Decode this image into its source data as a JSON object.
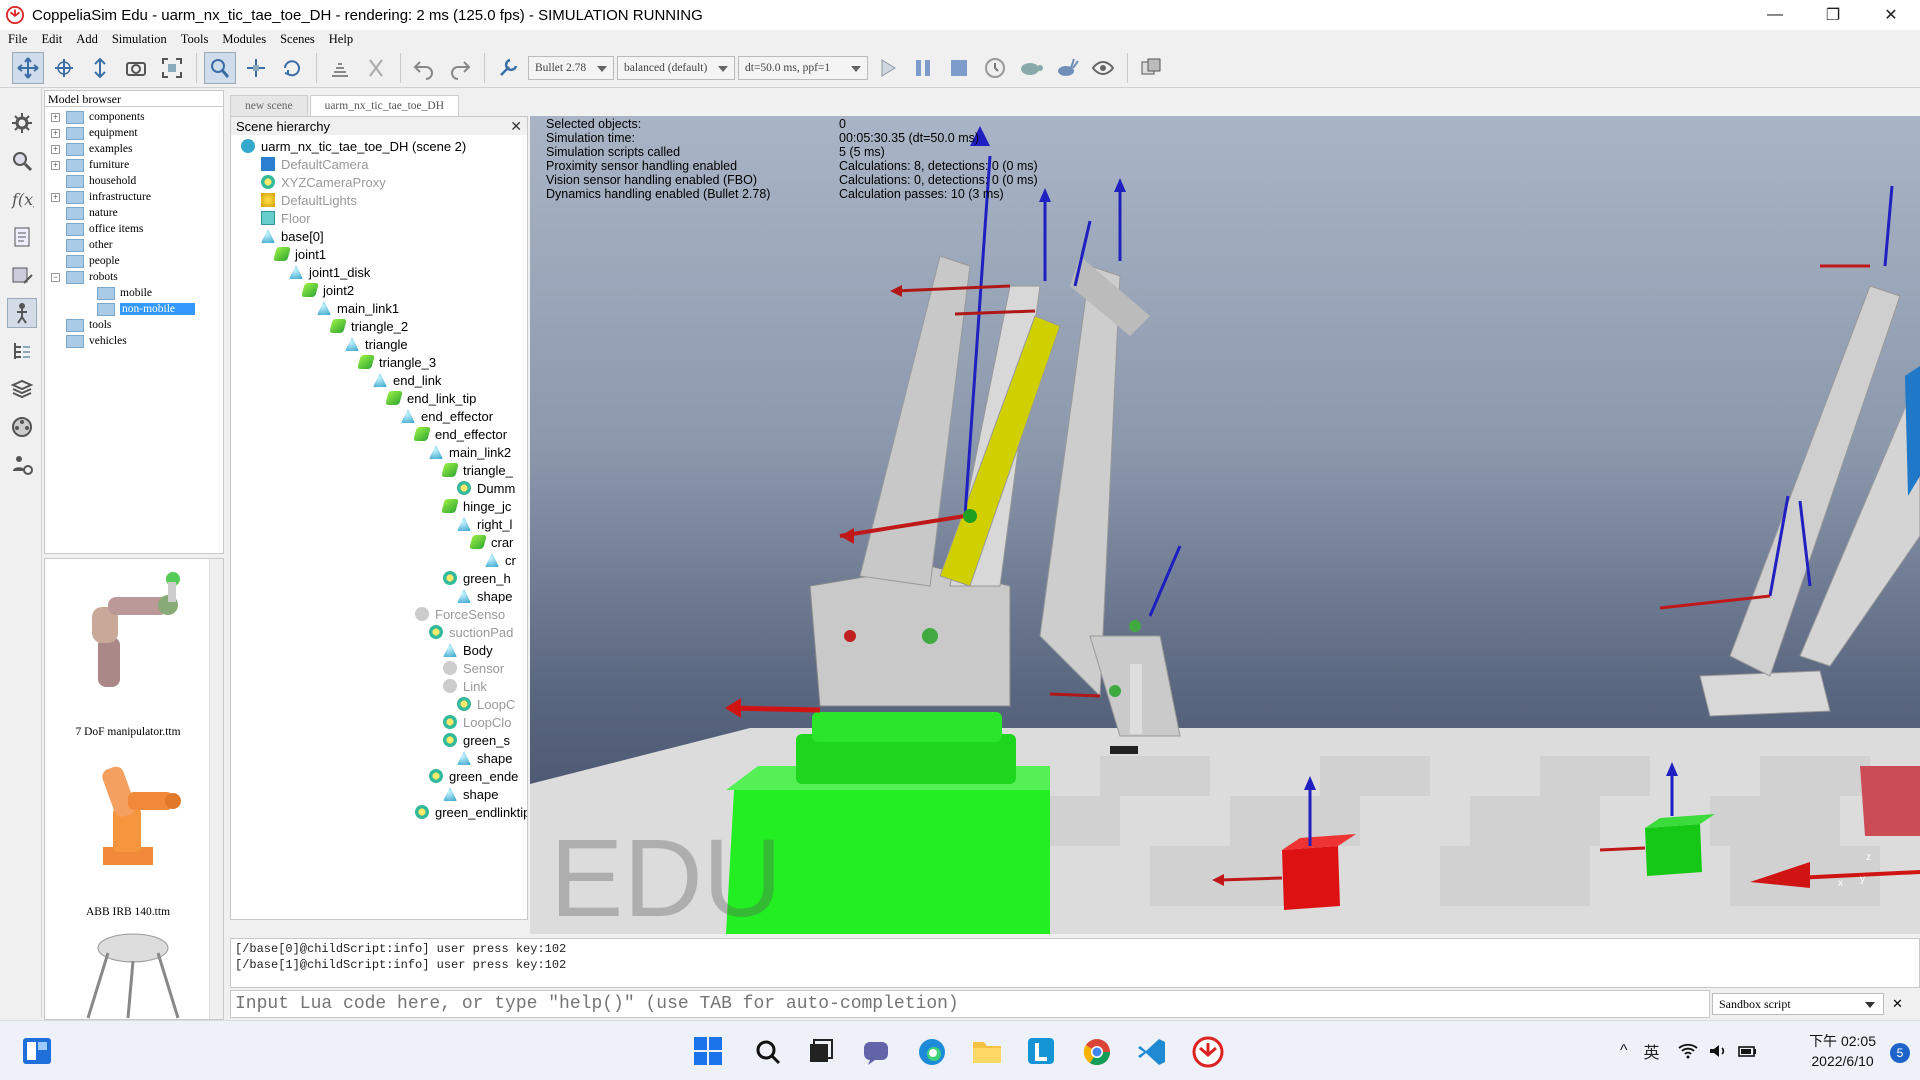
{
  "window": {
    "title": "CoppeliaSim Edu - uarm_nx_tic_tae_toe_DH - rendering: 2 ms (125.0 fps) - SIMULATION RUNNING",
    "minimize": "—",
    "restore": "❐",
    "close": "✕"
  },
  "menu": [
    "File",
    "Edit",
    "Add",
    "Simulation",
    "Tools",
    "Modules",
    "Scenes",
    "Help"
  ],
  "toolbar": {
    "engine": "Bullet 2.78",
    "accuracy": "balanced (default)",
    "dt": "dt=50.0 ms, ppf=1"
  },
  "model_browser": {
    "header": "Model browser",
    "items": [
      "components",
      "equipment",
      "examples",
      "furniture",
      "household",
      "infrastructure",
      "nature",
      "office items",
      "other",
      "people",
      "robots",
      "mobile",
      "non-mobile",
      "tools",
      "vehicles"
    ],
    "thumbnails": [
      "7 DoF manipulator.ttm",
      "ABB IRB 140.ttm"
    ]
  },
  "tabs": [
    "new scene",
    "uarm_nx_tic_tae_toe_DH"
  ],
  "hierarchy": {
    "header": "Scene hierarchy",
    "items": [
      "uarm_nx_tic_tae_toe_DH (scene 2)",
      "DefaultCamera",
      "XYZCameraProxy",
      "DefaultLights",
      "Floor",
      "base[0]",
      "joint1",
      "joint1_disk",
      "joint2",
      "main_link1",
      "triangle_2",
      "triangle",
      "triangle_3",
      "end_link",
      "end_link_tip",
      "end_effector",
      "end_effector",
      "main_link2",
      "triangle_",
      "Dumm",
      "hinge_jc",
      "right_l",
      "crar",
      "cr",
      "green_h",
      "shape",
      "ForceSenso",
      "suctionPad",
      "Body",
      "Sensor",
      "Link",
      "LoopC",
      "LoopClo",
      "green_s",
      "shape",
      "green_ende",
      "shape",
      "green_endlinktip"
    ]
  },
  "sim_info": {
    "labels": [
      "Selected objects:",
      "Simulation time:",
      "Simulation scripts called",
      "Proximity sensor handling enabled",
      "Vision sensor handling enabled (FBO)",
      "Dynamics handling enabled (Bullet 2.78)"
    ],
    "values": [
      "0",
      "00:05:30.35 (dt=50.0 ms)",
      "5 (5 ms)",
      "Calculations: 8, detections: 0 (0 ms)",
      "Calculations: 0, detections: 0 (0 ms)",
      "Calculation passes: 10 (3 ms)"
    ]
  },
  "viewport": {
    "watermark": "EDU",
    "axis_z": "z",
    "axis_x": "x",
    "axis_y": "y"
  },
  "console": [
    "[/base[0]@childScript:info] user press key:102",
    "[/base[1]@childScript:info] user press key:102"
  ],
  "command": {
    "placeholder": "Input Lua code here, or type \"help()\" (use TAB for auto-completion)",
    "mode": "Sandbox script",
    "close": "✕"
  },
  "taskbar": {
    "ime": "英",
    "time": "下午 02:05",
    "date": "2022/6/10",
    "notifications": "5",
    "caret": "^"
  },
  "colors": {
    "select": "#3399ff",
    "green": "#22ee22",
    "red": "#cc1111",
    "yellow": "#d8d81a"
  }
}
